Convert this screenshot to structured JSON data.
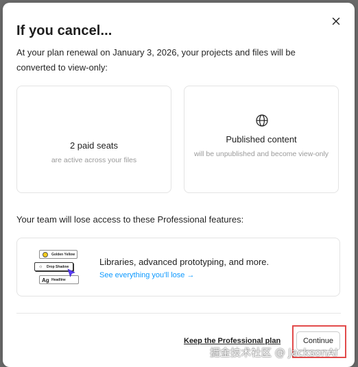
{
  "modal": {
    "title": "If you cancel...",
    "intro": "At your plan renewal on January 3, 2026, your projects and files will be converted to view-only:",
    "cards": [
      {
        "heading": "2 paid seats",
        "sub": "are active across your files"
      },
      {
        "icon": "globe-icon",
        "heading": "Published content",
        "sub": "will be unpublished and become view-only"
      }
    ],
    "lose_access_text": "Your team will lose access to these Professional features:",
    "feature": {
      "illustration": {
        "pill_1": "Golden Yellow",
        "pill_2": "Drop Shadow",
        "pill_3": "Headline",
        "pill_3_prefix": "Ag"
      },
      "text": "Libraries, advanced prototyping, and more.",
      "link": "See everything you'll lose →"
    },
    "keep_plan_label": "Keep the Professional plan",
    "continue_label": "Continue",
    "close_icon": "close-icon"
  },
  "colors": {
    "link_blue": "#0d99ff",
    "highlight_red": "#e24a4a",
    "swatch_yellow": "#f5cc1b"
  },
  "watermark": "掘金技术社区 @ JacksonAI"
}
